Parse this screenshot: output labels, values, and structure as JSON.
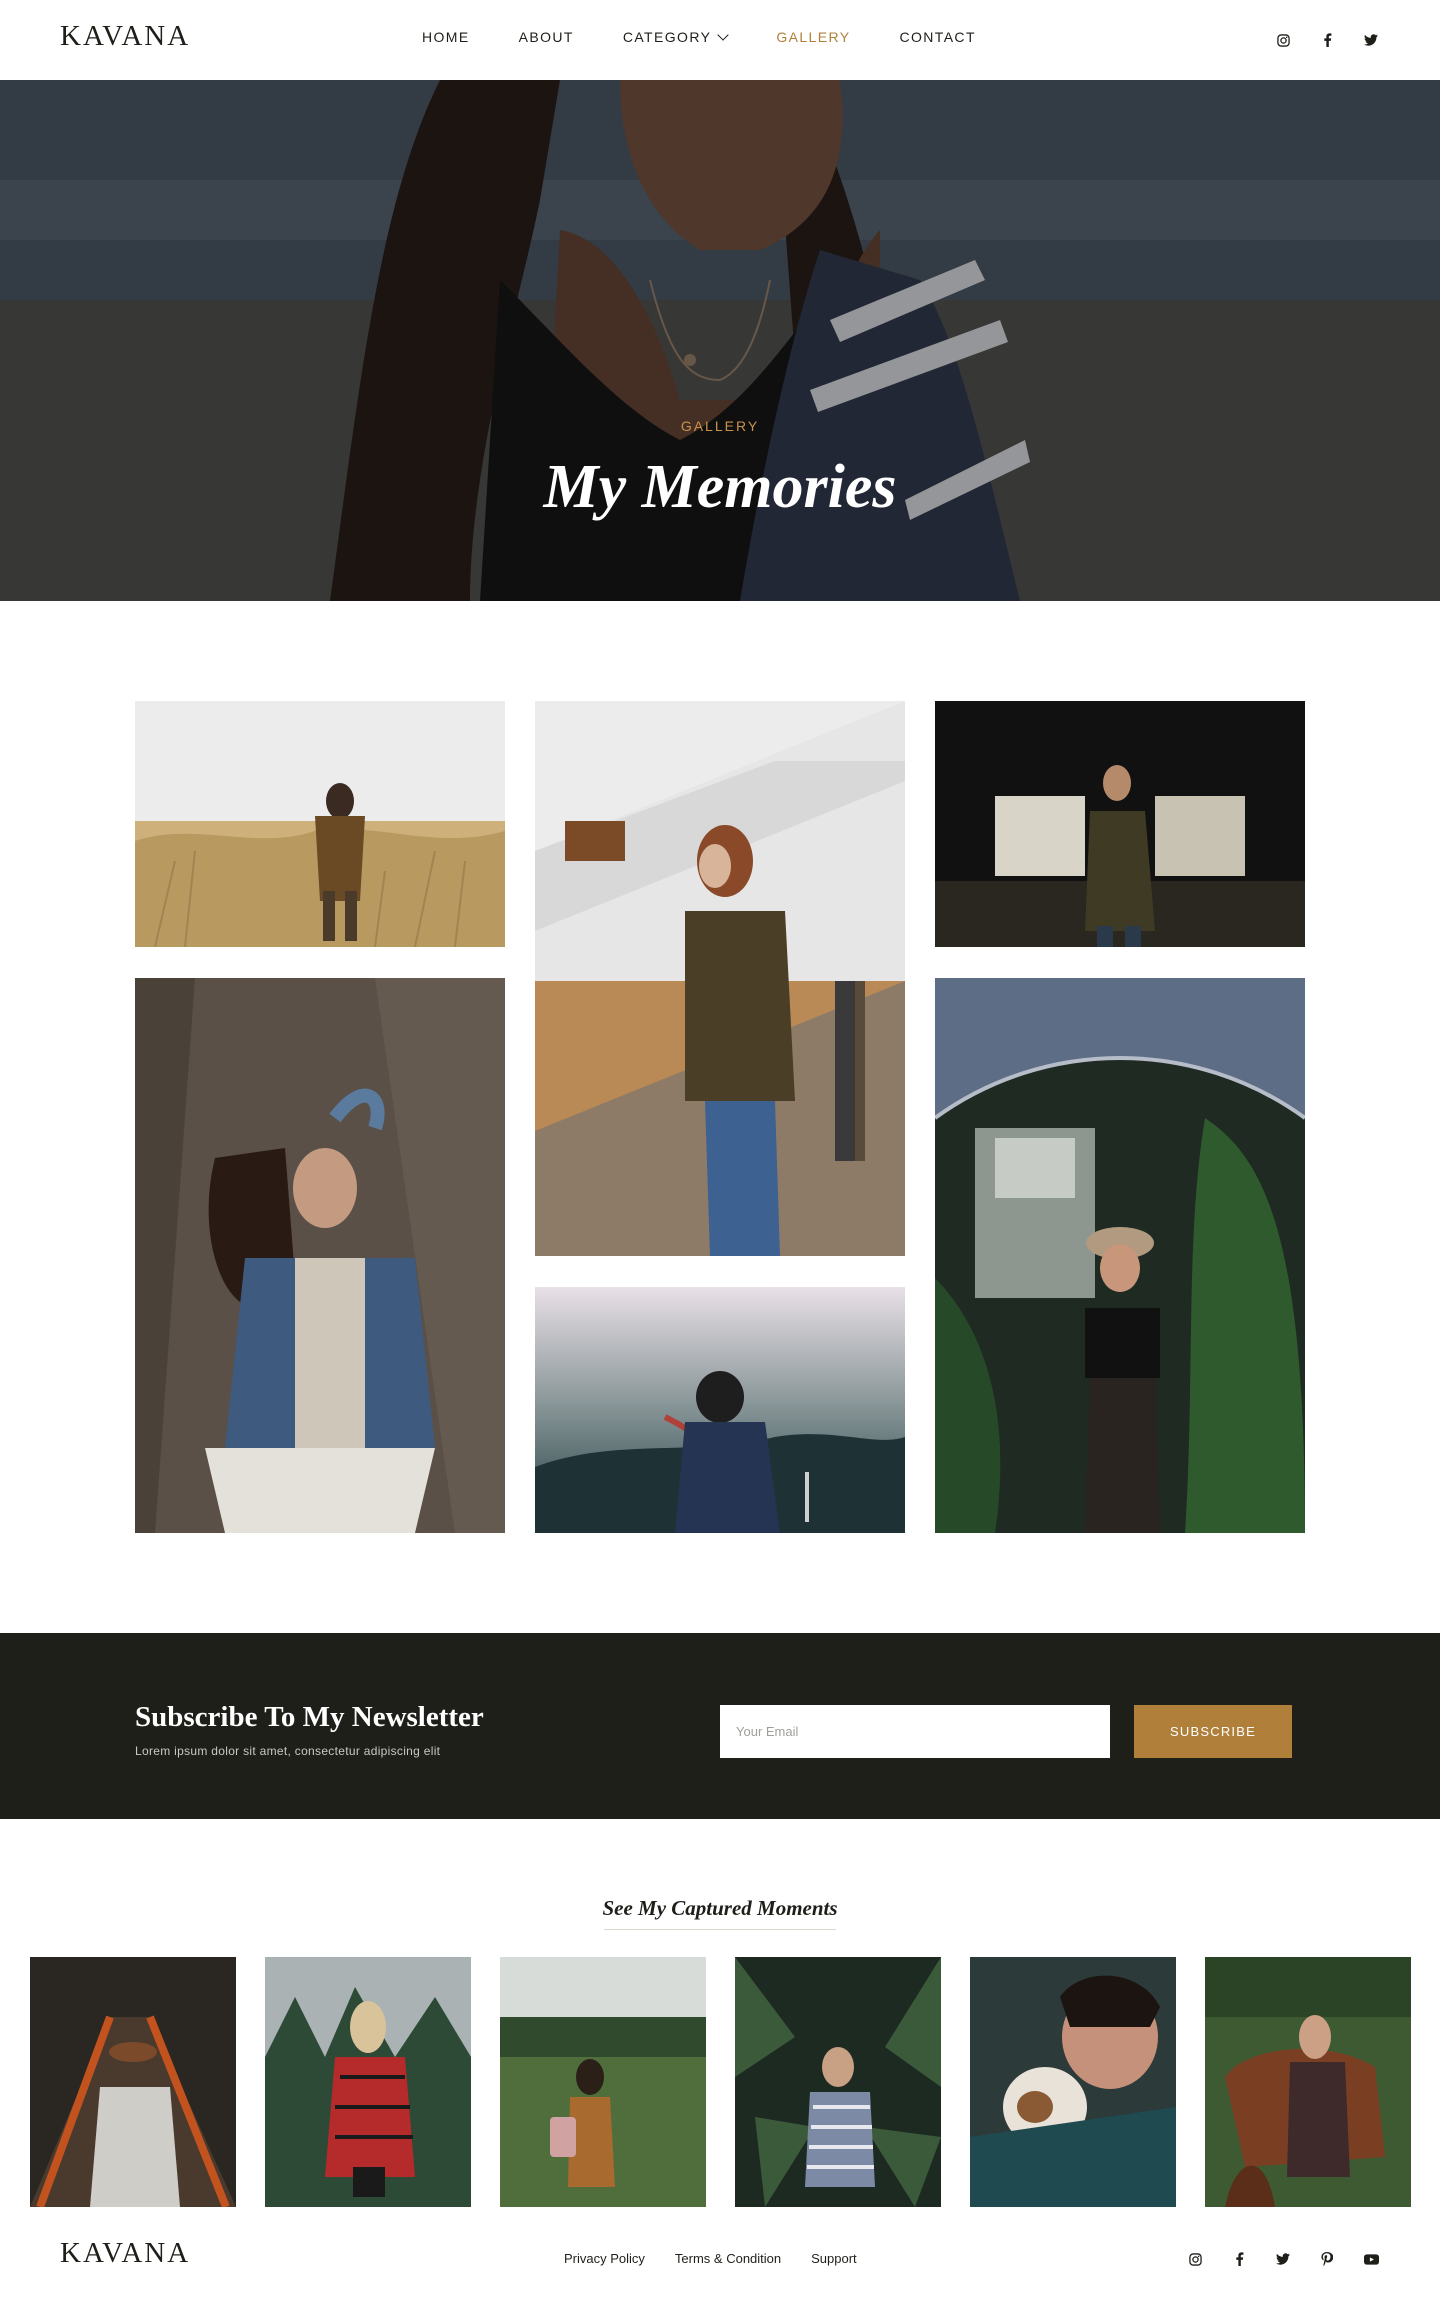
{
  "brand": {
    "logo": "KAVANA"
  },
  "nav": {
    "items": [
      {
        "label": "HOME"
      },
      {
        "label": "ABOUT"
      },
      {
        "label": "CATEGORY"
      },
      {
        "label": "GALLERY",
        "active": true
      },
      {
        "label": "CONTACT"
      }
    ]
  },
  "social_icons": [
    "instagram-icon",
    "facebook-icon",
    "twitter-icon"
  ],
  "hero": {
    "kicker": "GALLERY",
    "title": "My Memories"
  },
  "newsletter": {
    "title": "Subscribe To My Newsletter",
    "subtitle": "Lorem ipsum dolor sit amet, consectetur adipiscing elit",
    "input_placeholder": "Your Email",
    "button_label": "SUBSCRIBE"
  },
  "moments": {
    "title": "See My Captured Moments"
  },
  "footer": {
    "logo": "KAVANA",
    "links": [
      {
        "label": "Privacy Policy"
      },
      {
        "label": "Terms & Condition"
      },
      {
        "label": "Support"
      }
    ],
    "social_icons": [
      "instagram-icon",
      "facebook-icon",
      "twitter-icon",
      "pinterest-icon",
      "youtube-icon"
    ]
  },
  "colors": {
    "accent": "#b0803a",
    "dark": "#1f1f1a",
    "white": "#ffffff"
  }
}
